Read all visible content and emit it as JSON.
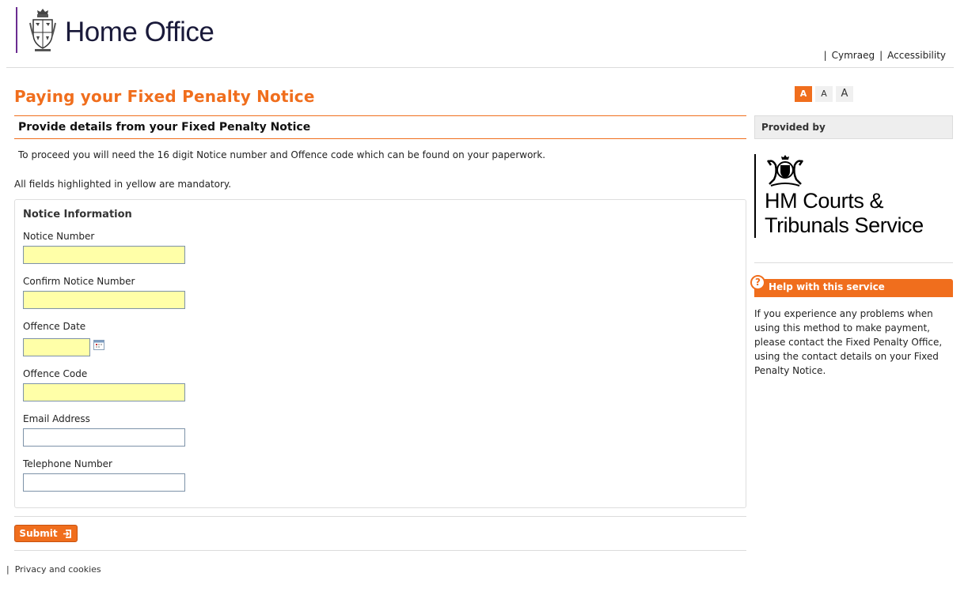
{
  "header": {
    "logo_text": "Home Office",
    "links": [
      {
        "label": "Cymraeg"
      },
      {
        "label": "Accessibility"
      }
    ]
  },
  "page": {
    "title": "Paying your Fixed Penalty Notice",
    "text_size_options": [
      "A",
      "A",
      "A"
    ]
  },
  "main": {
    "section_heading": "Provide details from your Fixed Penalty Notice",
    "intro": "To proceed you will need the 16 digit Notice number and Offence code which can be found on your paperwork.",
    "mandatory_note": "All fields highlighted in yellow are mandatory.",
    "fieldset_legend": "Notice Information",
    "fields": [
      {
        "label": "Notice Number",
        "value": "",
        "required": true
      },
      {
        "label": "Confirm Notice Number",
        "value": "",
        "required": true
      },
      {
        "label": "Offence Date",
        "value": "",
        "required": true
      },
      {
        "label": "Offence Code",
        "value": "",
        "required": true
      },
      {
        "label": "Email Address",
        "value": "",
        "required": false
      },
      {
        "label": "Telephone Number",
        "value": "",
        "required": false
      }
    ],
    "submit_label": "Submit"
  },
  "sidebar": {
    "provided_by": "Provided by",
    "provider_line1": "HM Courts &",
    "provider_line2": "Tribunals Service",
    "help_heading": "Help with this service",
    "help_text": "If you experience any problems when using this method to make payment, please contact the Fixed Penalty Office, using the contact details on your Fixed Penalty Notice."
  },
  "footer": {
    "privacy_link": "Privacy and cookies"
  },
  "colors": {
    "accent": "#f06e1d",
    "required_field": "#ffffa8",
    "brand_purple": "#6b2c91"
  },
  "icons": [
    "royal-crest-icon",
    "calendar-icon",
    "submit-arrow-icon",
    "royal-arms-icon",
    "help-question-icon"
  ]
}
